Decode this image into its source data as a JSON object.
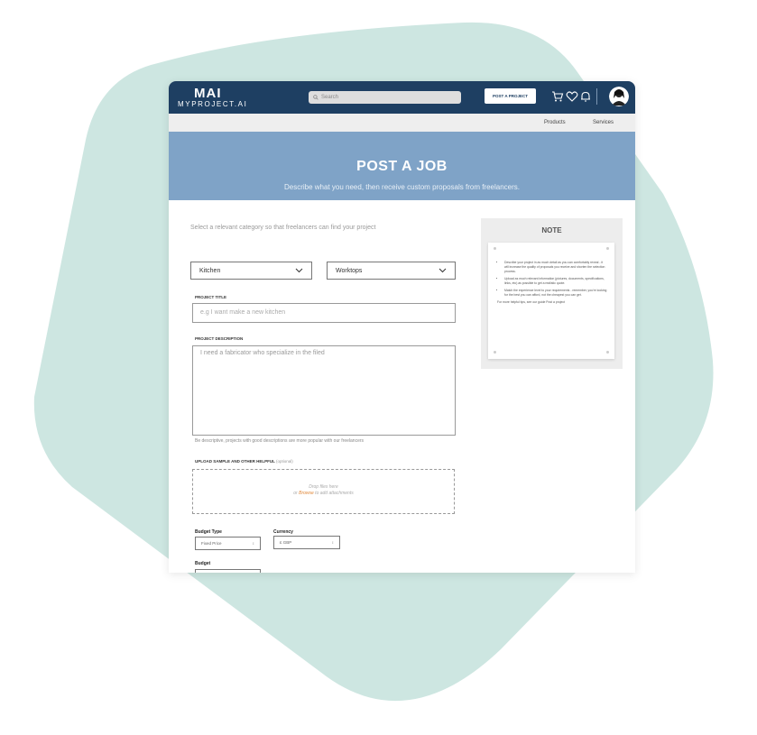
{
  "app": {
    "logo_main": "MAI",
    "logo_sub": "MYPROJECT.AI"
  },
  "header": {
    "search_placeholder": "Search",
    "post_button": "POST A PROJECT",
    "icons": [
      "cart-icon",
      "heart-icon",
      "bell-icon"
    ]
  },
  "subnav": {
    "items": [
      "Products",
      "Services"
    ]
  },
  "hero": {
    "title": "POST A JOB",
    "subtitle": "Describe what you need, then receive custom proposals from freelancers."
  },
  "form": {
    "intro": "Select a relevant category so that freelancers can find your project",
    "category": "Kitchen",
    "subcategory": "Worktops",
    "title_label": "PROJECT TITLE",
    "title_placeholder": "e.g I want make a new kitchen",
    "desc_label": "PROJECT DESCRIPTION",
    "desc_value": "I need a fabricator who specialize in the filed",
    "desc_hint": "Be descriptive, projects with good descriptions are more popular with our freelancers",
    "upload_label": "UPLOAD SAMPLE AND OTHER HELPFUL",
    "upload_optional": "(optional)",
    "drop_line1": "Drop files here",
    "drop_or": "or ",
    "drop_browse": "Browse",
    "drop_rest": " to add attachments",
    "budget_type_label": "Budget Type",
    "budget_type_value": "Fixed Price",
    "currency_label": "Currency",
    "currency_value": "£ GBP",
    "budget_label": "Budget"
  },
  "note": {
    "title": "NOTE",
    "items": [
      "Describe your project in as much detail as you can comfortably reveal - it will increase the quality of proposals you receive and shorten the selection process.",
      "Upload as much relevant information (pictures, documents, specifications, links, etc) as possible to get a realistic quote.",
      "Match the experience level to your requirements - remember, you're looking for the best you can afford, not the cheapest you can get."
    ],
    "footer": "For more helpful tips, see our guide Post a project"
  },
  "colors": {
    "topbar": "#1e3f62",
    "hero": "#7fa3c7",
    "backdrop": "#cde6e1",
    "link": "#e0893b"
  }
}
